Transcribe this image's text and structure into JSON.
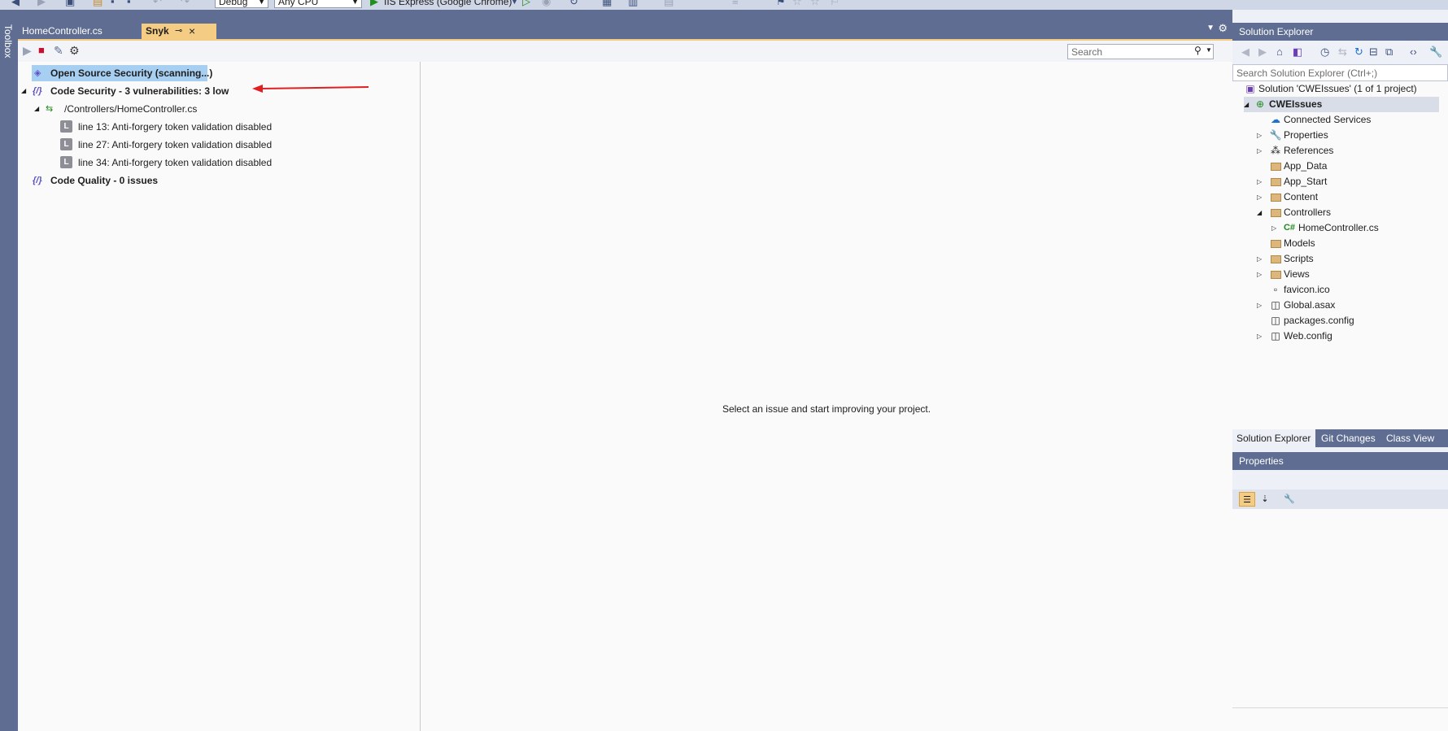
{
  "toolbar": {
    "config": "Debug",
    "platform": "Any CPU",
    "run_target": "IIS Express (Google Chrome)"
  },
  "toolbox": {
    "label": "Toolbox"
  },
  "tabs": {
    "home_controller": "HomeController.cs",
    "snyk": "Snyk"
  },
  "snyk": {
    "search_placeholder": "Search",
    "tree": {
      "open_source": "Open Source Security (scanning...)",
      "code_security": "Code Security - 3 vulnerabilities: 3 low",
      "file": "/Controllers/HomeController.cs",
      "issues": [
        "line 13: Anti-forgery token validation disabled",
        "line 27: Anti-forgery token validation disabled",
        "line 34: Anti-forgery token validation disabled"
      ],
      "code_quality": "Code Quality - 0 issues",
      "low_badge": "L"
    },
    "detail_message": "Select an issue and start improving your project."
  },
  "solution_explorer": {
    "title": "Solution Explorer",
    "search_placeholder": "Search Solution Explorer (Ctrl+;)",
    "solution": "Solution 'CWEIssues' (1 of 1 project)",
    "project": "CWEIssues",
    "items": [
      "Connected Services",
      "Properties",
      "References",
      "App_Data",
      "App_Start",
      "Content",
      "Controllers",
      "HomeController.cs",
      "Models",
      "Scripts",
      "Views",
      "favicon.ico",
      "Global.asax",
      "packages.config",
      "Web.config"
    ],
    "cs_badge": "C#",
    "tabs": [
      "Solution Explorer",
      "Git Changes",
      "Class View"
    ]
  },
  "properties": {
    "title": "Properties"
  },
  "colors": {
    "chrome": "#5e6d91",
    "accent_tab": "#f5cc84",
    "selection": "#a7cff2",
    "arrow": "#e02020"
  }
}
